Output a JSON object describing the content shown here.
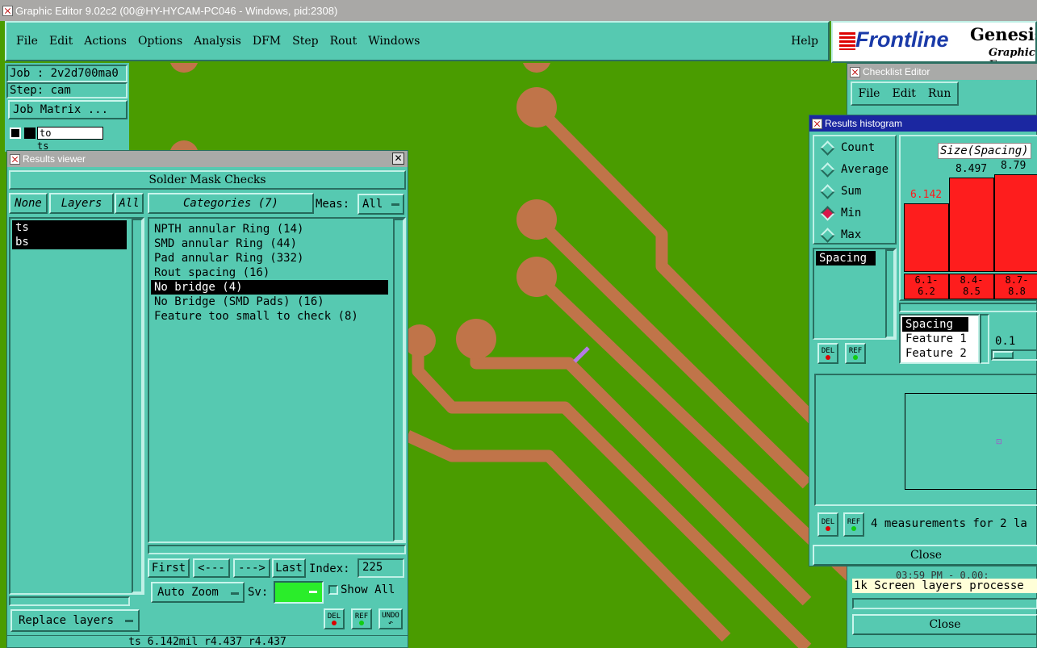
{
  "window_title": "Graphic Editor 9.02c2 (00@HY-HYCAM-PC046 - Windows, pid:2308)",
  "menu": [
    "File",
    "Edit",
    "Actions",
    "Options",
    "Analysis",
    "DFM",
    "Step",
    "Rout",
    "Windows"
  ],
  "help_label": "Help",
  "logo": {
    "brand": "Frontline",
    "product": "Genesis",
    "sub": "Graphic E"
  },
  "job": {
    "job_label": "Job : 2v2d700ma0",
    "step_label": "Step: cam",
    "matrix_button": "Job Matrix ..."
  },
  "layers_panel": {
    "rows": [
      "to",
      "ts"
    ]
  },
  "results_viewer": {
    "title": "Results viewer",
    "header": "Solder Mask Checks",
    "none_btn": "None",
    "layers_btn": "Layers",
    "all_btn": "All",
    "categories_btn": "Categories (7)",
    "meas_label": "Meas:",
    "meas_value": "All",
    "layers": [
      "ts",
      "bs"
    ],
    "categories": [
      "NPTH annular Ring (14)",
      "SMD annular Ring (44)",
      "Pad annular Ring (332)",
      "Rout spacing (16)",
      "No bridge (4)",
      "No Bridge (SMD Pads) (16)",
      "Feature too small to check (8)"
    ],
    "selected_category_index": 4,
    "nav": {
      "first": "First",
      "prev": "<---",
      "next": "--->",
      "last": "Last",
      "index_label": "Index:",
      "index_value": "225"
    },
    "auto_zoom": "Auto Zoom",
    "sv_label": "Sv:",
    "show_all": "Show All",
    "replace_layers": "Replace layers",
    "del": "DEL",
    "ref": "REF",
    "undo": "UNDO",
    "status": "ts 6.142mil  r4.437  r4.437"
  },
  "checklist_editor": {
    "title": "Checklist Editor",
    "menu": [
      "File",
      "Edit",
      "Run"
    ],
    "log_line1": "03:59 PM - 0.00:",
    "log_line2": "1k Screen layers processe",
    "close": "Close"
  },
  "histogram": {
    "title": "Results histogram",
    "modes": [
      "Count",
      "Average",
      "Sum",
      "Min",
      "Max"
    ],
    "selected_mode": "Min",
    "chart_title": "Size(Spacing)",
    "list_left": [
      "Spacing"
    ],
    "list_right": [
      "Spacing",
      "Feature 1",
      "Feature 2"
    ],
    "scale_value": "0.1",
    "summary": "4 measurements for 2 la",
    "close": "Close",
    "del": "DEL",
    "ref": "REF"
  },
  "chart_data": {
    "type": "bar",
    "title": "Size(Spacing)",
    "categories": [
      "6.1-\n6.2",
      "8.4-\n8.5",
      "8.7-\n8.8"
    ],
    "category_top": [
      "6.1-",
      "8.4-",
      "8.7-"
    ],
    "category_bottom": [
      "6.2",
      "8.5",
      "8.8"
    ],
    "values": [
      6.142,
      8.497,
      8.79
    ],
    "value_labels": [
      "6.142",
      "8.497",
      "8.79"
    ],
    "ylim": [
      0,
      10
    ],
    "bar_color": "#fe1d1d"
  },
  "colors": {
    "accent": "#56c9b1",
    "board": "#4a9c00",
    "copper": "#c07449",
    "bar": "#fe1d1d"
  }
}
